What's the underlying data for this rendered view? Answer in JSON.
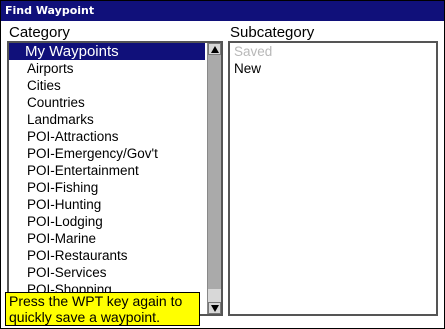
{
  "window": {
    "title": "Find Waypoint"
  },
  "category": {
    "header": "Category",
    "items": [
      "My Waypoints",
      "Airports",
      "Cities",
      "Countries",
      "Landmarks",
      "POI-Attractions",
      "POI-Emergency/Gov't",
      "POI-Entertainment",
      "POI-Fishing",
      "POI-Hunting",
      "POI-Lodging",
      "POI-Marine",
      "POI-Restaurants",
      "POI-Services",
      "POI-Shopping"
    ],
    "selected_index": 0
  },
  "subcategory": {
    "header": "Subcategory",
    "items": [
      {
        "label": "Saved",
        "enabled": false
      },
      {
        "label": "New",
        "enabled": true
      }
    ]
  },
  "tooltip": {
    "line1": "Press the WPT key again to",
    "line2": "quickly save a waypoint."
  },
  "colors": {
    "titlebar": "#10107a",
    "selection": "#10107a",
    "tooltip_bg": "#ffff00"
  },
  "icons": [
    "scroll-up-arrow-icon",
    "scroll-down-arrow-icon"
  ]
}
